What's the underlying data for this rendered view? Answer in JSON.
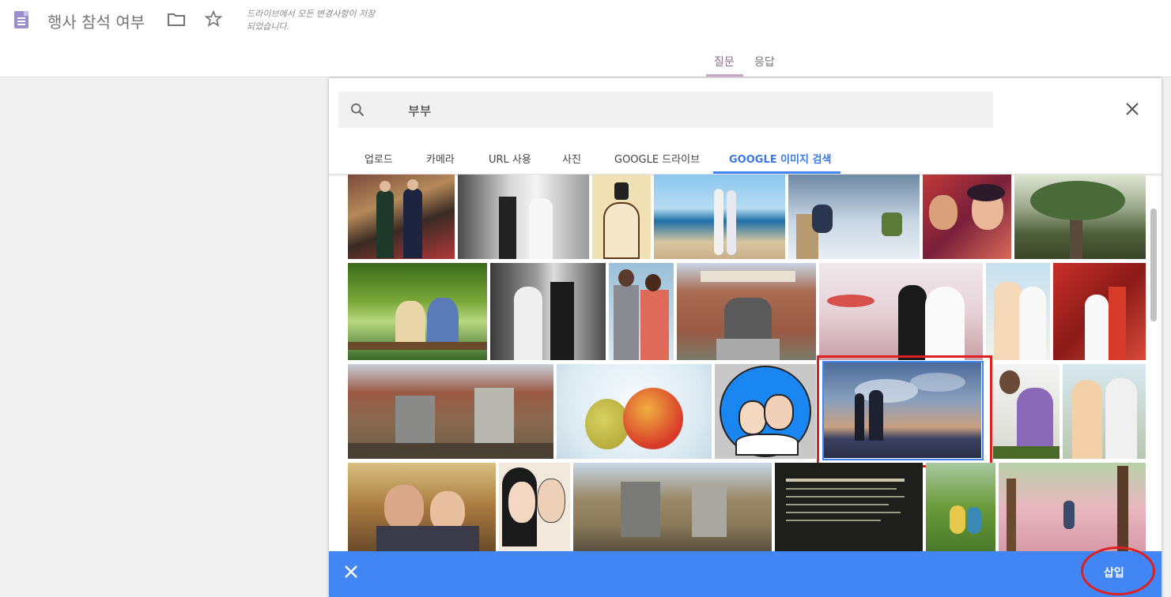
{
  "app": {
    "title": "행사 참석 여부",
    "save_status": "드라이브에서 모든 변경사항이 저장되었습니다.",
    "tabs": [
      {
        "label": "질문",
        "active": true
      },
      {
        "label": "응답",
        "active": false
      }
    ]
  },
  "dialog": {
    "search": {
      "value": "부부",
      "placeholder": ""
    },
    "tabs": [
      {
        "label": "업로드",
        "active": false
      },
      {
        "label": "카메라",
        "active": false
      },
      {
        "label": "URL 사용",
        "active": false
      },
      {
        "label": "사진",
        "active": false
      },
      {
        "label": "GOOGLE 드라이브",
        "active": false
      },
      {
        "label": "GOOGLE 이미지 검색",
        "active": true
      }
    ],
    "insert_label": "삽입",
    "accent_color": "#4285f4",
    "selected_image": "couple silhouette at sunset"
  },
  "icons": {
    "doc": "forms-doc-icon",
    "folder": "folder-icon",
    "star": "star-icon",
    "search": "search-icon",
    "close": "close-icon",
    "cancel": "close-icon"
  }
}
